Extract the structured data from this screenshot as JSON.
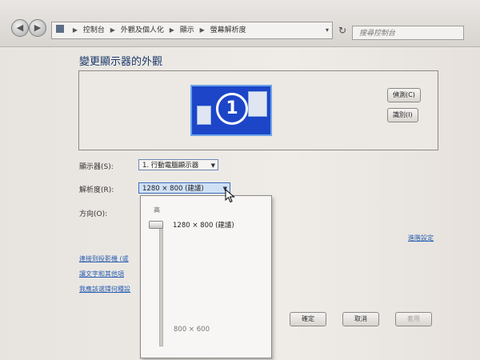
{
  "nav": {
    "back_icon": "back-arrow-icon",
    "forward_icon": "forward-arrow-icon",
    "back_glyph": "◀",
    "forward_glyph": "▶"
  },
  "address_bar": {
    "crumbs": [
      "控制台",
      "外觀及個人化",
      "顯示",
      "螢幕解析度"
    ],
    "dropdown_glyph": "▾"
  },
  "refresh": {
    "icon": "refresh-icon",
    "glyph": "↻"
  },
  "search": {
    "placeholder": "搜尋控制台"
  },
  "page": {
    "title": "變更顯示器的外觀",
    "detect_button": "偵測(C)",
    "identify_button": "識別(I)",
    "monitor_number": "1"
  },
  "form": {
    "display_label": "顯示器(S):",
    "display_value": "1. 行動電腦顯示器",
    "resolution_label": "解析度(R):",
    "resolution_value": "1280 × 800 (建議)",
    "orientation_label": "方向(O):",
    "advanced_link": "進階設定"
  },
  "links": {
    "projector": "連接到投影機 (或",
    "text_size": "讓文字和其他項",
    "which_settings": "我應該選擇何種設"
  },
  "resolution_popup": {
    "high_label": "高",
    "top_option": "1280 × 800 (建議)",
    "low_option": "800 × 600",
    "slider_level": 1.0
  },
  "buttons": {
    "ok": "確定",
    "cancel": "取消",
    "apply": "套用"
  },
  "colors": {
    "monitor_fill": "#1d45c8",
    "link": "#2a5fb0",
    "heading": "#1c3a6a"
  }
}
